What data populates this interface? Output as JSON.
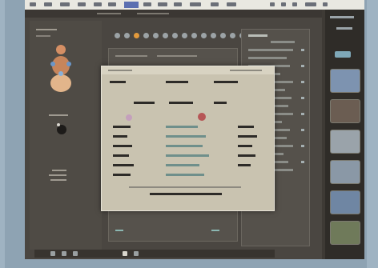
{
  "menu": {
    "selected_index": 5,
    "items_count_note": ""
  },
  "colors": {
    "menubar": "#e9e8e1",
    "workspace": "#4a4641",
    "dialog": "#c9c3b0",
    "accent_red": "#b65656",
    "selection_blue": "#5b6fb1",
    "teal": "#6f8f8b"
  },
  "icons": {
    "toolbar": [
      "tool-icon",
      "tool-icon",
      "orange-tool-icon",
      "tool-icon",
      "tool-icon",
      "tool-icon",
      "tool-icon",
      "tool-icon",
      "tool-icon",
      "tool-icon",
      "tool-icon",
      "tool-icon",
      "tool-icon",
      "tool-icon",
      "tool-icon"
    ],
    "dock": [
      "app-icon",
      "app-icon",
      "app-icon",
      "app-icon",
      "app-icon"
    ]
  },
  "thumbnails": [
    {
      "name": "photo-thumbnail",
      "tone": "#7d93b0"
    },
    {
      "name": "photo-thumbnail",
      "tone": "#6b5d52"
    },
    {
      "name": "photo-thumbnail",
      "tone": "#9aa3aa"
    },
    {
      "name": "photo-thumbnail",
      "tone": "#8a98a6"
    },
    {
      "name": "photo-thumbnail",
      "tone": "#6f86a3"
    },
    {
      "name": "photo-thumbnail",
      "tone": "#6f7a5a"
    }
  ]
}
